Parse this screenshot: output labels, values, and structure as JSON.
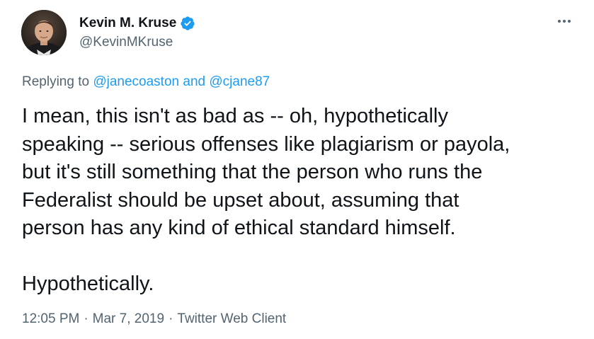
{
  "author": {
    "display_name": "Kevin M. Kruse",
    "handle": "@KevinMKruse",
    "verified": true
  },
  "icons": {
    "avatar": "profile-photo",
    "verified": "verified-badge-icon",
    "more": "more-options-icon"
  },
  "reply": {
    "prefix": "Replying to",
    "mention_1": "@janecoaston",
    "conjunction": "and",
    "mention_2": "@cjane87"
  },
  "tweet": {
    "lines": [
      "I mean, this isn't as bad as -- oh, hypothetically",
      "speaking -- serious offenses like plagiarism or payola,",
      "but it's still something that the person who runs the",
      "Federalist should be upset about, assuming that",
      "person has any kind of ethical standard himself."
    ],
    "closing": "Hypothetically."
  },
  "meta": {
    "time": "12:05 PM",
    "separator": "·",
    "date": "Mar 7, 2019",
    "client": "Twitter Web Client"
  },
  "colors": {
    "text_primary": "#0f1419",
    "text_secondary": "#536471",
    "link": "#1d9bf0",
    "verified": "#1d9bf0"
  }
}
